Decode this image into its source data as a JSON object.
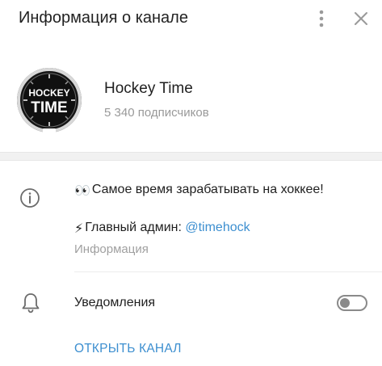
{
  "header": {
    "title": "Информация о канале",
    "more_icon": "vertical-dots-icon",
    "close_icon": "close-icon"
  },
  "channel": {
    "name": "Hockey Time",
    "subscribers": "5 340 подписчиков",
    "avatar_text_line1": "HOCKEY",
    "avatar_text_line2": "TIME"
  },
  "info": {
    "icon": "info-icon",
    "description_line1_emoji": "👀",
    "description_line1": "Самое время зарабатывать на хоккее!",
    "description_line2_emoji": "⚡",
    "description_line2_prefix": "Главный админ: ",
    "admin_link": "@timehock",
    "caption": "Информация"
  },
  "notifications": {
    "icon": "bell-icon",
    "label": "Уведомления",
    "enabled": false
  },
  "actions": {
    "open_channel": "ОТКРЫТЬ КАНАЛ"
  },
  "colors": {
    "accent": "#3d8fd0",
    "secondary_text": "#999999",
    "toggle_off": "#8a8a8a"
  }
}
